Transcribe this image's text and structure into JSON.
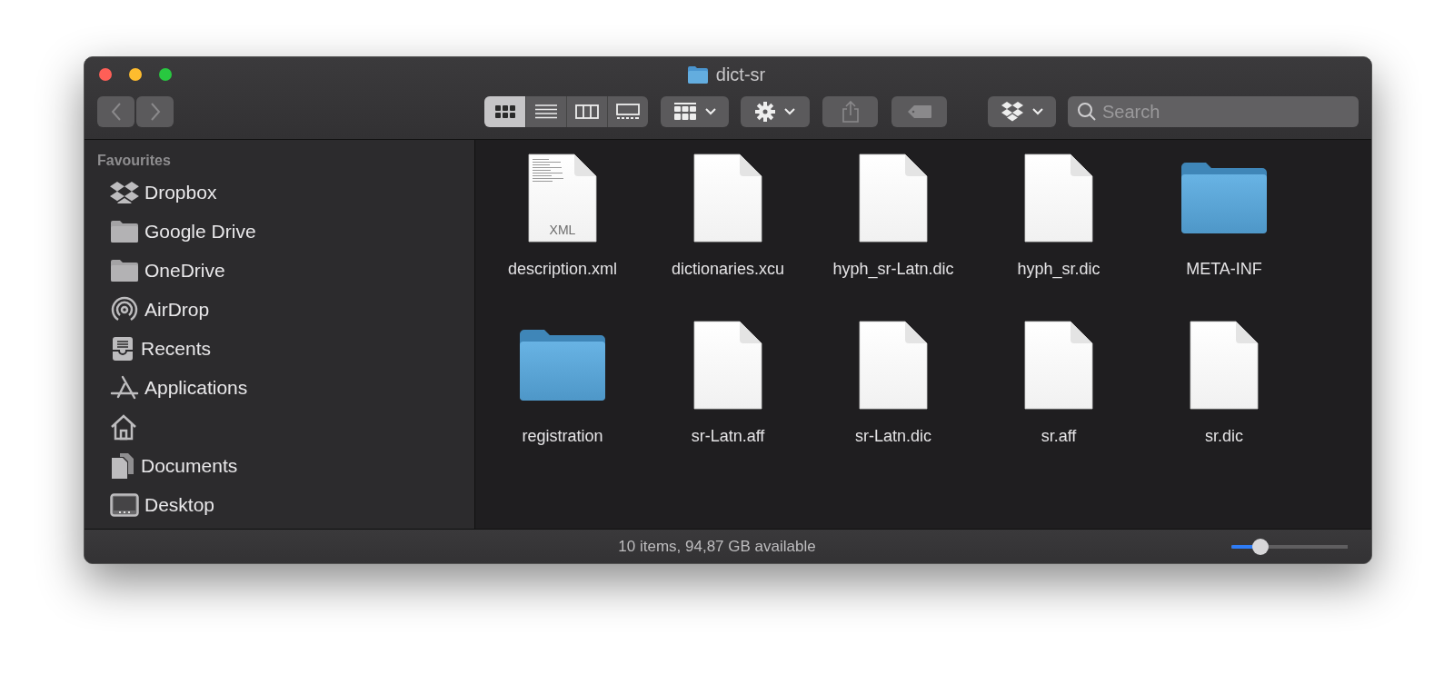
{
  "window": {
    "title": "dict-sr"
  },
  "toolbar": {
    "view_modes": [
      {
        "kind": "icons",
        "selected": true
      },
      {
        "kind": "list",
        "selected": false
      },
      {
        "kind": "columns",
        "selected": false
      },
      {
        "kind": "gallery",
        "selected": false
      }
    ],
    "search": {
      "placeholder": "Search"
    }
  },
  "sidebar": {
    "section": "Favourites",
    "items": [
      {
        "kind": "dropbox",
        "label": "Dropbox"
      },
      {
        "kind": "folder",
        "label": "Google Drive"
      },
      {
        "kind": "folder",
        "label": "OneDrive"
      },
      {
        "kind": "airdrop",
        "label": "AirDrop"
      },
      {
        "kind": "recents",
        "label": "Recents"
      },
      {
        "kind": "applications",
        "label": "Applications"
      },
      {
        "kind": "home"
      },
      {
        "kind": "documents",
        "label": "Documents"
      },
      {
        "kind": "desktop",
        "label": "Desktop"
      }
    ]
  },
  "files": [
    {
      "kind": "xml",
      "name": "description.xml",
      "badge": "XML"
    },
    {
      "kind": "document",
      "name": "dictionaries.xcu"
    },
    {
      "kind": "document",
      "name": "hyph_sr-Latn.dic"
    },
    {
      "kind": "document",
      "name": "hyph_sr.dic"
    },
    {
      "kind": "folder",
      "name": "META-INF"
    },
    {
      "kind": "folder",
      "name": "registration"
    },
    {
      "kind": "document",
      "name": "sr-Latn.aff"
    },
    {
      "kind": "document",
      "name": "sr-Latn.dic"
    },
    {
      "kind": "document",
      "name": "sr.aff"
    },
    {
      "kind": "document",
      "name": "sr.dic"
    }
  ],
  "status_bar": {
    "text": "10 items, 94,87 GB available",
    "zoom_slider": {
      "level": 0.25
    }
  }
}
